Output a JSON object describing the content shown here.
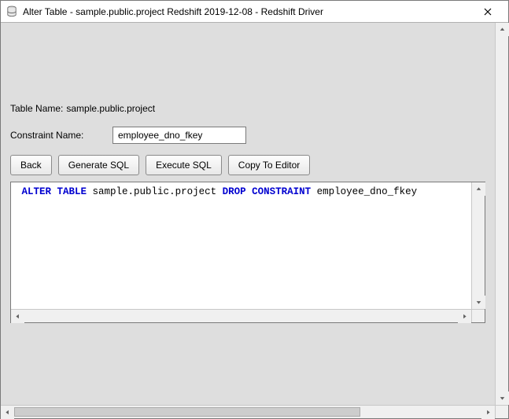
{
  "window": {
    "title": "Alter Table - sample.public.project Redshift 2019-12-08 - Redshift Driver"
  },
  "labels": {
    "table_name_prefix": "Table Name:",
    "table_name_value": "sample.public.project",
    "constraint_name": "Constraint Name:"
  },
  "fields": {
    "constraint_name_value": "employee_dno_fkey"
  },
  "buttons": {
    "back": "Back",
    "generate_sql": "Generate SQL",
    "execute_sql": "Execute SQL",
    "copy_to_editor": "Copy To Editor"
  },
  "sql": {
    "kw_alter_table": "ALTER TABLE",
    "obj": "sample.public.project",
    "kw_drop_constraint": "DROP CONSTRAINT",
    "constraint": "employee_dno_fkey"
  }
}
